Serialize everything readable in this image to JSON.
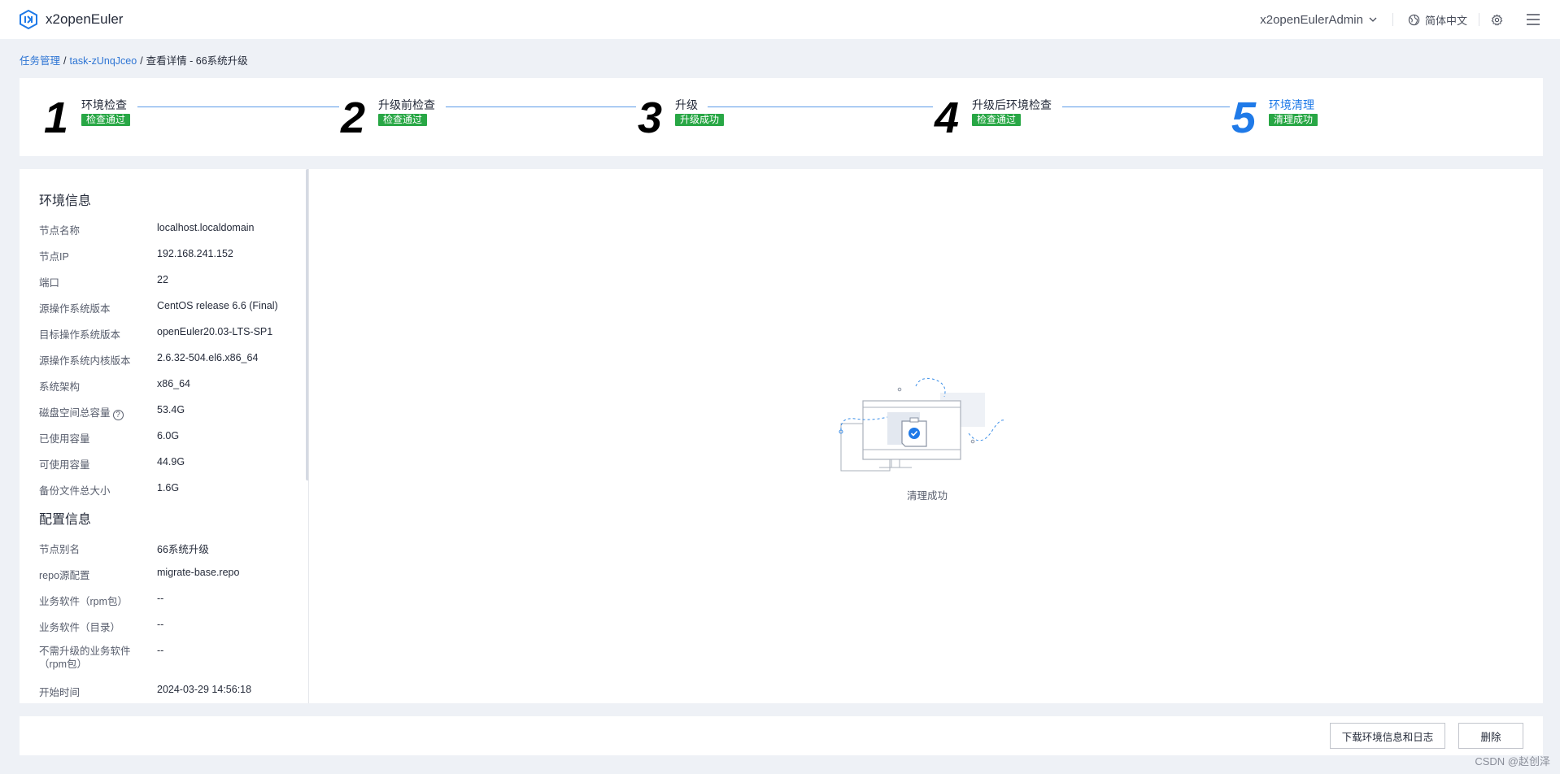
{
  "app": {
    "title": "x2openEuler"
  },
  "header": {
    "user": "x2openEulerAdmin",
    "language": "简体中文"
  },
  "breadcrumb": {
    "root": "任务管理",
    "task": "task-zUnqJceo",
    "current": "查看详情 - 66系统升级"
  },
  "steps": [
    {
      "num": "1",
      "title": "环境检查",
      "status": "检查通过"
    },
    {
      "num": "2",
      "title": "升级前检查",
      "status": "检查通过"
    },
    {
      "num": "3",
      "title": "升级",
      "status": "升级成功"
    },
    {
      "num": "4",
      "title": "升级后环境检查",
      "status": "检查通过"
    },
    {
      "num": "5",
      "title": "环境清理",
      "status": "清理成功"
    }
  ],
  "env": {
    "title": "环境信息",
    "rows": [
      {
        "k": "节点名称",
        "v": "localhost.localdomain"
      },
      {
        "k": "节点IP",
        "v": "192.168.241.152"
      },
      {
        "k": "端口",
        "v": "22"
      },
      {
        "k": "源操作系统版本",
        "v": "CentOS release 6.6 (Final)"
      },
      {
        "k": "目标操作系统版本",
        "v": "openEuler20.03-LTS-SP1"
      },
      {
        "k": "源操作系统内核版本",
        "v": "2.6.32-504.el6.x86_64"
      },
      {
        "k": "系统架构",
        "v": "x86_64"
      },
      {
        "k": "磁盘空间总容量",
        "v": "53.4G"
      },
      {
        "k": "已使用容量",
        "v": "6.0G"
      },
      {
        "k": "可使用容量",
        "v": "44.9G"
      },
      {
        "k": "备份文件总大小",
        "v": "1.6G"
      }
    ]
  },
  "config": {
    "title": "配置信息",
    "rows": [
      {
        "k": "节点别名",
        "v": "66系统升级"
      },
      {
        "k": "repo源配置",
        "v": "migrate-base.repo"
      },
      {
        "k": "业务软件（rpm包）",
        "v": "--"
      },
      {
        "k": "业务软件（目录）",
        "v": "--"
      },
      {
        "k": "不需升级的业务软件",
        "k2": "（rpm包）",
        "v": "--"
      },
      {
        "k": "开始时间",
        "v": "2024-03-29 14:56:18"
      }
    ]
  },
  "result": {
    "text": "清理成功"
  },
  "footer": {
    "download": "下载环境信息和日志",
    "delete": "删除"
  },
  "watermark": "CSDN @赵创泽",
  "colors": {
    "accent": "#1f7ae8",
    "success": "#28a745",
    "link": "#2e75d4"
  }
}
